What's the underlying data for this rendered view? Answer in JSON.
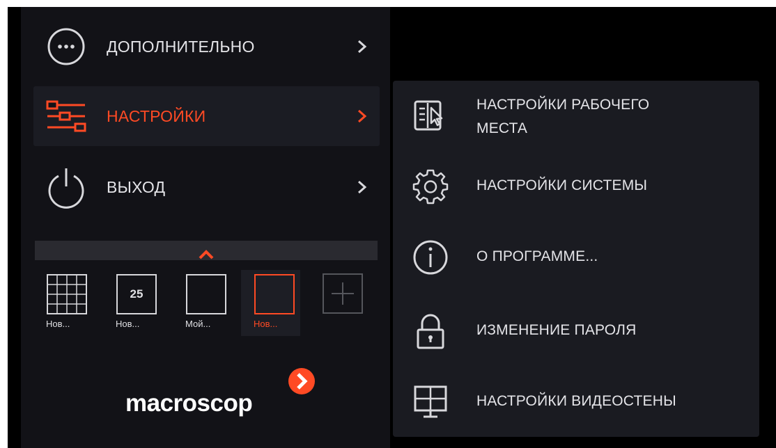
{
  "menu": {
    "items": [
      {
        "label": "ДОПОЛНИТЕЛЬНО",
        "icon": "more-circle-icon"
      },
      {
        "label": "НАСТРОЙКИ",
        "icon": "sliders-icon",
        "active": true
      },
      {
        "label": "ВЫХОД",
        "icon": "power-icon"
      }
    ]
  },
  "layouts": {
    "tiles": [
      {
        "caption": "Нов...",
        "icon": "grid-layout-icon"
      },
      {
        "caption": "Нов...",
        "icon": "numbered-layout-icon",
        "number": "25"
      },
      {
        "caption": "Мой...",
        "icon": "single-layout-icon"
      },
      {
        "caption": "Нов...",
        "icon": "single-layout-icon",
        "selected": true
      }
    ],
    "add_icon": "plus-icon",
    "collapse_icon": "chevron-up-icon"
  },
  "logo": {
    "text": "macroscop",
    "icon": "chevron-right-badge-icon"
  },
  "submenu": {
    "items": [
      {
        "label_line1": "НАСТРОЙКИ РАБОЧЕГО",
        "label_line2": "МЕСТА",
        "icon": "workstation-icon"
      },
      {
        "label_line1": "НАСТРОЙКИ СИСТЕМЫ",
        "icon": "gear-icon"
      },
      {
        "label_line1": "О ПРОГРАММЕ...",
        "icon": "info-icon"
      },
      {
        "label_line1": "ИЗМЕНЕНИЕ ПАРОЛЯ",
        "icon": "lock-icon"
      },
      {
        "label_line1": "НАСТРОЙКИ ВИДЕОСТЕНЫ",
        "icon": "video-wall-icon"
      }
    ]
  },
  "colors": {
    "accent": "#ff4a24",
    "panel": "#121217",
    "submenu": "#1a1b21",
    "text": "#e4e4e8"
  }
}
